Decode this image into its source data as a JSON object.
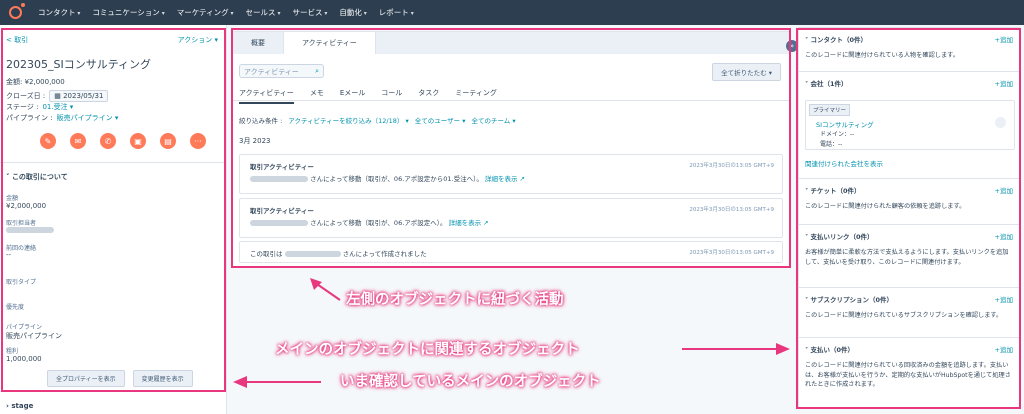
{
  "nav": {
    "items": [
      "コンタクト",
      "コミュニケーション",
      "マーケティング",
      "セールス",
      "サービス",
      "自動化",
      "レポート"
    ],
    "icons": [
      "search-icon",
      "help-icon",
      "marketplace-icon",
      "settings-icon",
      "bell-icon"
    ]
  },
  "left": {
    "back_label": "< 取引",
    "actions_label": "アクション ▾",
    "deal_name": "202305_SIコンサルティング",
    "amount": "金額: ¥2,000,000",
    "close_label": "クローズ日 :",
    "close_date": "2023/05/31",
    "stage_label": "ステージ :",
    "stage_value": "01.受注 ▾",
    "pipeline_label": "パイプライン :",
    "pipeline_value": "販売パイプライン ▾",
    "about_title": "この取引について",
    "props": {
      "amount_label": "金額",
      "amount_value": "¥2,000,000",
      "owner_label": "取引担当者",
      "activity_label": "前回の連絡",
      "activity_value": "--",
      "type_label": "取引タイプ",
      "priority_label": "優先度",
      "pipeline_label": "パイプライン",
      "pipeline_value": "販売パイプライン",
      "profit_label": "粗利",
      "profit_value": "1,000,000"
    },
    "show_all_button": "全プロパティーを表示",
    "history_button": "変更履歴を表示",
    "stage_section": "stage"
  },
  "middle": {
    "tabs": [
      "概要",
      "アクティビティー"
    ],
    "search_placeholder": "アクティビティー",
    "collapse_label": "全て折りたたむ ▾",
    "subtabs": [
      "アクティビティー",
      "メモ",
      "Eメール",
      "コール",
      "タスク",
      "ミーティング"
    ],
    "filter_label": "絞り込み条件 :",
    "filter_activity": "アクティビティーを絞り込み（12/18）",
    "filter_users": "全てのユーザー",
    "filter_teams": "全てのチーム",
    "month": "3月 2023",
    "cards": [
      {
        "title": "取引アクティビティー",
        "body": "さんによって移動（取引が、06.アポ設定から01.受注へ）。",
        "details": "詳細を表示",
        "ts": "2023年3月30日の13:05 GMT+9"
      },
      {
        "title": "取引アクティビティー",
        "body": "さんによって移動（取引が、06.アポ設定へ）。",
        "details": "詳細を表示",
        "ts": "2023年3月30日の13:05 GMT+9"
      }
    ],
    "created_prefix": "この取引は",
    "created_suffix": "さんによって作成されました",
    "created_ts": "2023年3月30日の13:05 GMT+9"
  },
  "right": {
    "add_label": "+追加",
    "contacts_title": "コンタクト（0件）",
    "contacts_text": "このレコードに関連付けられている人物を確認します。",
    "companies_title": "会社（1件）",
    "primary_tag": "プライマリー",
    "company_name": "SIコンサルティング",
    "company_domain": "ドメイン：--",
    "company_phone": "電話：--",
    "companies_link": "関連付けられた会社を表示",
    "tickets_title": "チケット（0件）",
    "tickets_text": "このレコードに関連付けられた顧客の依頼を追跡します。",
    "paylinks_title": "支払いリンク（0件）",
    "paylinks_text": "お客様が簡単に柔軟な方法で支払えるようにします。支払いリンクを追加して、支払いを受け取り、このレコードに関連付けます。",
    "subs_title": "サブスクリプション（0件）",
    "subs_text": "このレコードに関連付けられているサブスクリプションを確認します。",
    "payments_title": "支払い（0件）",
    "payments_text": "このレコードに関連付けられている回収済みの金額を追跡します。支払いは、お客様が支払いを行うか、定期的な支払いがHubSpotを通じて処理されたときに作成されます。"
  },
  "annotations": {
    "activity": "左側のオブジェクトに紐づく活動",
    "related": "メインのオブジェクトに関連するオブジェクト",
    "main": "いま確認しているメインのオブジェクト",
    "color": "#e8377e"
  }
}
